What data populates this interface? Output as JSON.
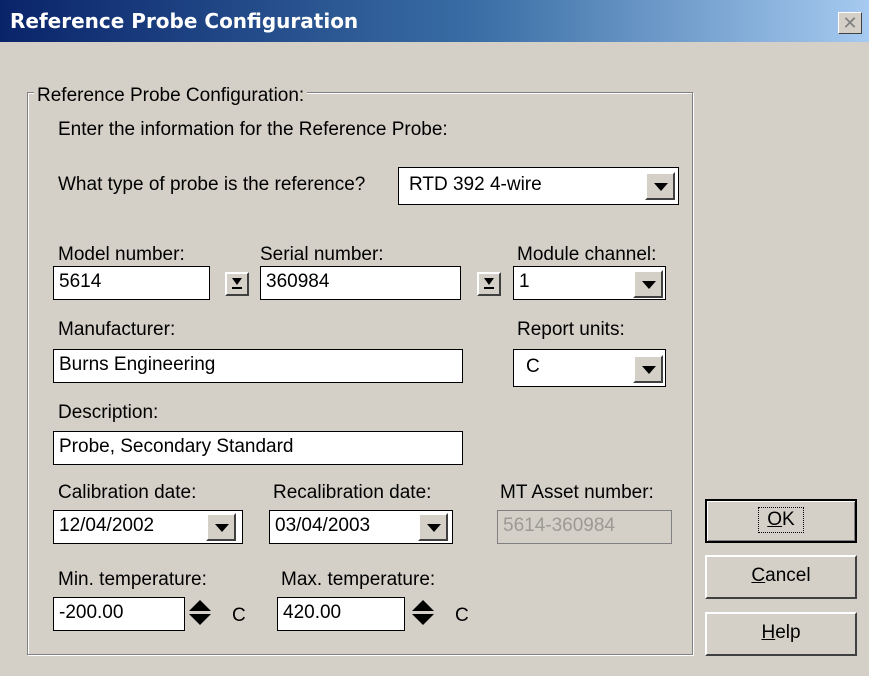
{
  "window": {
    "title": "Reference Probe Configuration",
    "close_glyph": "✕"
  },
  "group": {
    "title": "Reference Probe Configuration:",
    "instruction": "Enter the information for the Reference Probe:"
  },
  "probe_type": {
    "label": "What type of probe is the reference?",
    "value": "RTD 392 4-wire"
  },
  "model_number": {
    "label": "Model number:",
    "value": "5614"
  },
  "serial_number": {
    "label": "Serial number:",
    "value": "360984"
  },
  "module_channel": {
    "label": "Module channel:",
    "value": "1"
  },
  "manufacturer": {
    "label": "Manufacturer:",
    "value": "Burns Engineering"
  },
  "report_units": {
    "label": "Report units:",
    "value": "C"
  },
  "description": {
    "label": "Description:",
    "value": "Probe, Secondary Standard"
  },
  "calibration_date": {
    "label": "Calibration date:",
    "value": "12/04/2002"
  },
  "recalibration_date": {
    "label": "Recalibration date:",
    "value": "03/04/2003"
  },
  "asset_number": {
    "label": "MT Asset number:",
    "value": "5614-360984"
  },
  "min_temperature": {
    "label": "Min. temperature:",
    "value": "-200.00",
    "unit": "C"
  },
  "max_temperature": {
    "label": "Max. temperature:",
    "value": "420.00",
    "unit": "C"
  },
  "buttons": {
    "ok": {
      "accel": "O",
      "rest": "K"
    },
    "cancel": {
      "accel": "C",
      "rest": "ancel"
    },
    "help": {
      "accel": "H",
      "rest": "elp"
    }
  },
  "icons": {
    "close": "close-icon",
    "dropdown": "chevron-down-icon",
    "lookup": "download-arrow-icon",
    "spinner": "up-down-spinner-icon"
  }
}
